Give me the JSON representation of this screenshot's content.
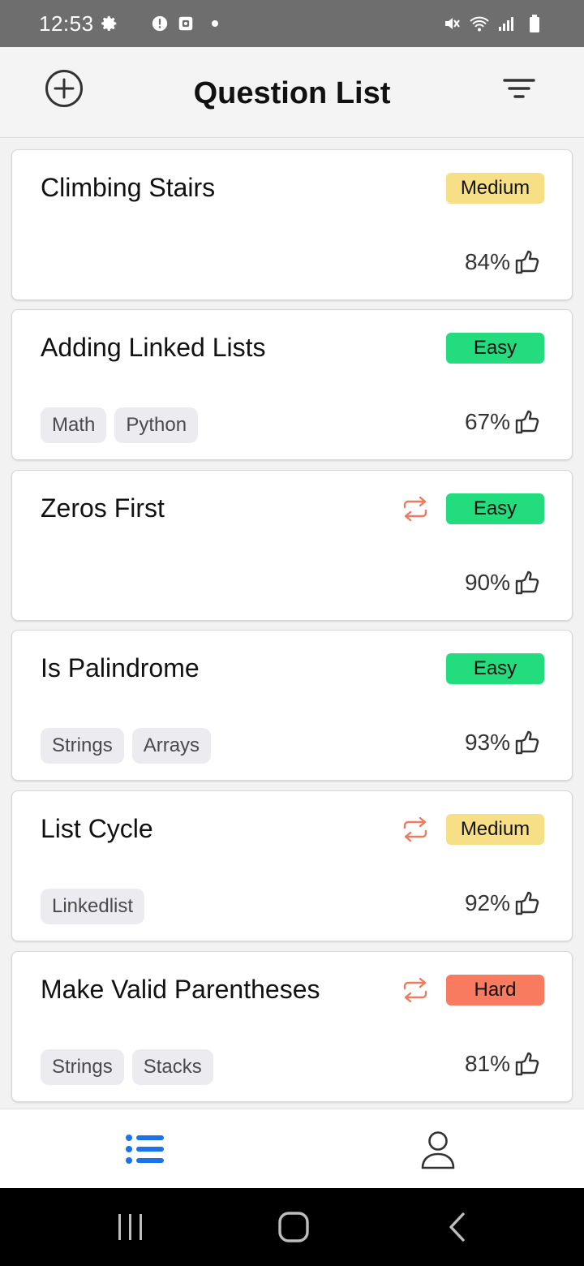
{
  "status_bar": {
    "time": "12:53",
    "left_icons": [
      "gear-icon",
      "alert-icon",
      "screenshot-icon",
      "dot-icon"
    ],
    "right_icons": [
      "mute-icon",
      "wifi-icon",
      "signal-icon",
      "battery-icon"
    ]
  },
  "header": {
    "title": "Question List",
    "add_icon": "plus-circle-icon",
    "filter_icon": "filter-icon"
  },
  "colors": {
    "medium": "#f7df86",
    "easy": "#22dc7d",
    "hard": "#f87a5f",
    "repeat_icon": "#ec7b5f",
    "active_tab": "#1a73e8"
  },
  "questions": [
    {
      "title": "Climbing Stairs",
      "difficulty": "Medium",
      "repeat": false,
      "tags": [],
      "rating": "84%"
    },
    {
      "title": "Adding Linked Lists",
      "difficulty": "Easy",
      "repeat": false,
      "tags": [
        "Math",
        "Python"
      ],
      "rating": "67%"
    },
    {
      "title": "Zeros First",
      "difficulty": "Easy",
      "repeat": true,
      "tags": [],
      "rating": "90%"
    },
    {
      "title": "Is Palindrome",
      "difficulty": "Easy",
      "repeat": false,
      "tags": [
        "Strings",
        "Arrays"
      ],
      "rating": "93%"
    },
    {
      "title": "List Cycle",
      "difficulty": "Medium",
      "repeat": true,
      "tags": [
        "Linkedlist"
      ],
      "rating": "92%"
    },
    {
      "title": "Make Valid Parentheses",
      "difficulty": "Hard",
      "repeat": true,
      "tags": [
        "Strings",
        "Stacks"
      ],
      "rating": "81%"
    }
  ],
  "tab_bar": {
    "tabs": [
      {
        "icon": "list-icon",
        "active": true
      },
      {
        "icon": "profile-icon",
        "active": false
      }
    ]
  },
  "nav_bar": {
    "buttons": [
      "recents-icon",
      "home-icon",
      "back-icon"
    ]
  }
}
